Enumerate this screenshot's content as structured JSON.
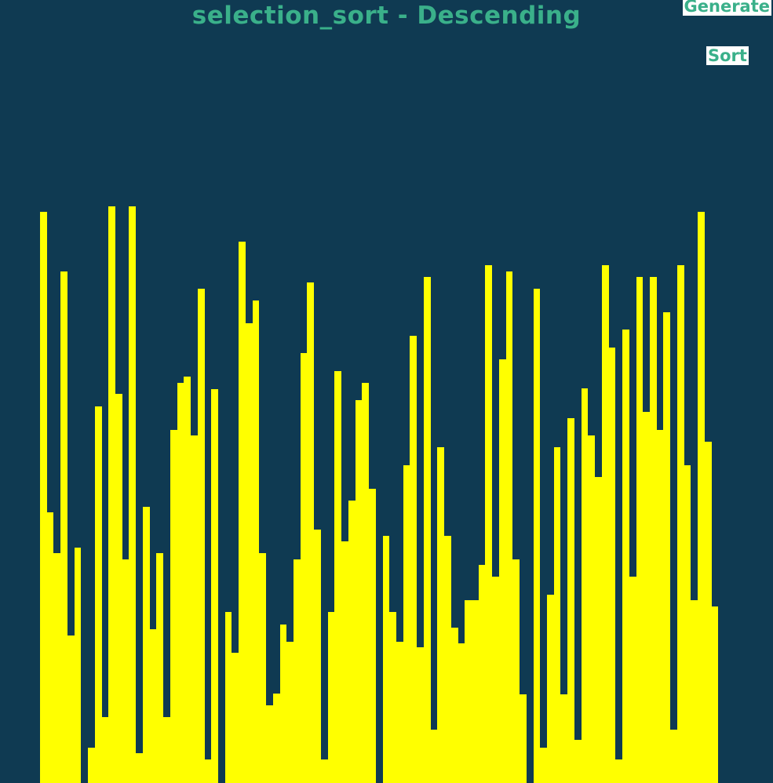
{
  "title": "selection_sort - Descending",
  "buttons": {
    "generate_label": "Generate",
    "sort_label": "Sort"
  },
  "colors": {
    "background": "#0f3a52",
    "bar": "#ffff00",
    "accent": "#3ab08a",
    "button_bg": "#ffffff"
  },
  "bars": {
    "max_value": 735,
    "values": [
      728,
      345,
      293,
      652,
      188,
      300,
      0,
      45,
      480,
      84,
      735,
      496,
      285,
      735,
      38,
      352,
      196,
      293,
      84,
      450,
      510,
      518,
      443,
      630,
      30,
      502,
      0,
      218,
      166,
      690,
      586,
      615,
      293,
      99,
      114,
      202,
      180,
      285,
      548,
      638,
      323,
      30,
      218,
      525,
      308,
      360,
      488,
      510,
      375,
      0,
      315,
      218,
      180,
      405,
      570,
      173,
      645,
      68,
      428,
      315,
      198,
      178,
      233,
      233,
      278,
      660,
      263,
      540,
      652,
      285,
      113,
      0,
      630,
      45,
      240,
      428,
      113,
      465,
      55,
      503,
      443,
      390,
      660,
      555,
      30,
      578,
      263,
      645,
      473,
      645,
      450,
      600,
      68,
      660,
      405,
      233,
      728,
      435,
      225
    ]
  }
}
